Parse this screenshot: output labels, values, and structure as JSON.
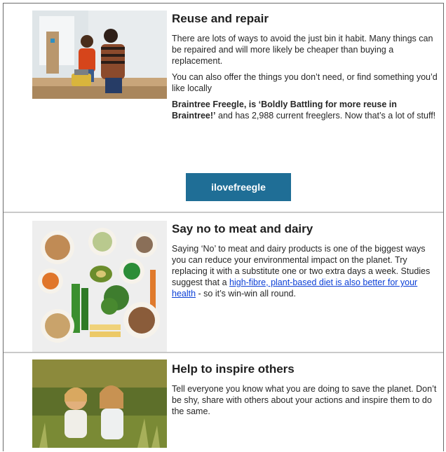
{
  "sections": [
    {
      "title": "Reuse and repair",
      "image_icon": "family-repair-photo",
      "paragraphs": [
        "There are lots of ways to avoid the just bin it habit.  Many things can be repaired and will more likely be cheaper than buying a replacement.",
        "You can also offer the things you don’t need, or find something you’d like locally"
      ],
      "bold_text": "Braintree Freegle, is ‘Boldly Battling for more reuse in Braintree!’",
      "after_bold": " and has 2,988 current freeglers. Now that’s a lot of stuff!",
      "button_label": "ilovefreegle"
    },
    {
      "title": "Say no to meat and dairy",
      "image_icon": "plant-food-bowls-photo",
      "para_before_link": "Saying ‘No’ to meat and dairy products is one of the biggest ways you can reduce your environmental impact on the planet. Try replacing it with a substitute one or two extra days a week. Studies suggest that a ",
      "link_text": "high-fibre, plant-based diet is also better for your health",
      "para_after_link": " - so it’s win-win all round."
    },
    {
      "title": "Help to inspire others",
      "image_icon": "children-in-meadow-photo",
      "paragraphs": [
        "Tell everyone you know what you are doing to save the planet.  Don’t be shy, share with others about your actions and inspire them to do the same."
      ]
    }
  ],
  "colors": {
    "button_bg": "#1f6e96",
    "link": "#0b3fd6",
    "divider": "#c9c9c9"
  }
}
